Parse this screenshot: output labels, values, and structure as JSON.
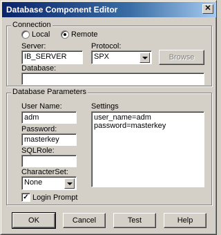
{
  "window": {
    "title": "Database Component Editor"
  },
  "connection": {
    "group_label": "Connection",
    "local_label": "Local",
    "remote_label": "Remote",
    "selected": "remote",
    "server_label": "Server:",
    "server_value": "IB_SERVER",
    "protocol_label": "Protocol:",
    "protocol_value": "SPX",
    "browse_label": "Browse",
    "database_label": "Database:",
    "database_value": ""
  },
  "params": {
    "group_label": "Database Parameters",
    "username_label": "User Name:",
    "username_value": "adm",
    "password_label": "Password:",
    "password_value": "masterkey",
    "sqlrole_label": "SQLRole:",
    "sqlrole_value": "",
    "charset_label": "CharacterSet:",
    "charset_value": "None",
    "settings_label": "Settings",
    "settings_lines": [
      "user_name=adm",
      "password=masterkey"
    ],
    "login_prompt_label": "Login Prompt",
    "login_prompt_checked": true
  },
  "buttons": {
    "ok": "OK",
    "cancel": "Cancel",
    "test": "Test",
    "help": "Help"
  },
  "icons": {
    "close": "close-icon",
    "check": "check-icon",
    "dropdown": "chevron-down-icon"
  }
}
